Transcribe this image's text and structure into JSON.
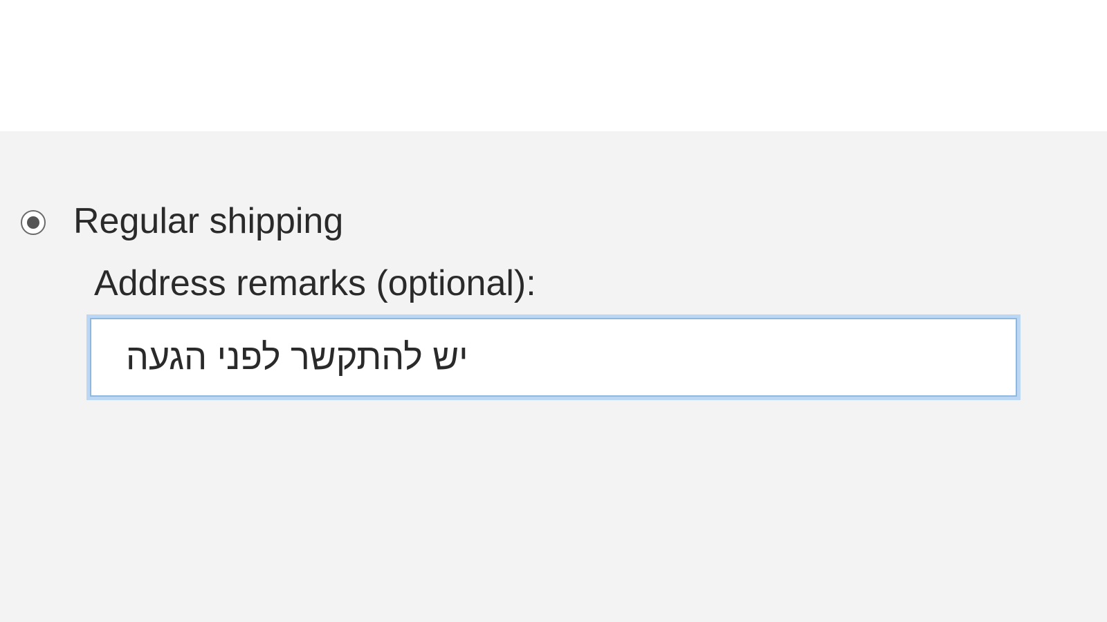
{
  "shipping": {
    "option_label": "Regular shipping",
    "option_selected": true,
    "remarks_label": "Address remarks (optional):",
    "remarks_value": "יש להתקשר לפני הגעה"
  }
}
